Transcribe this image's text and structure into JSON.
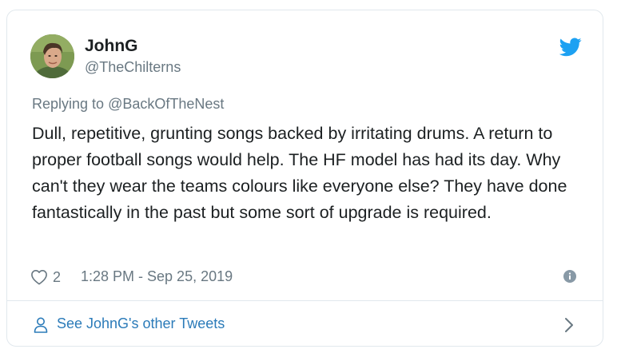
{
  "author": {
    "display_name": "JohnG",
    "handle": "@TheChilterns"
  },
  "tweet": {
    "reply_prefix": "Replying to ",
    "reply_to": "@BackOfTheNest",
    "text": "Dull, repetitive, grunting songs backed by irritating drums. A return to proper football songs would help. The HF model has had its day. Why can't they wear the teams colours like everyone else? They have done fantastically in the past but some sort of upgrade is required.",
    "like_count": "2",
    "timestamp": "1:28 PM - Sep 25, 2019"
  },
  "footer": {
    "label": "See JohnG's other Tweets"
  },
  "colors": {
    "brand": "#1da1f2",
    "link": "#2b7bb9",
    "secondary_text": "#697882",
    "border": "#e1e8ed"
  },
  "icons": {
    "logo": "twitter-bird-icon",
    "like": "heart-outline-icon",
    "info": "info-circle-icon",
    "footer": "user-outline-icon",
    "footer_arrow": "chevron-right-icon"
  }
}
